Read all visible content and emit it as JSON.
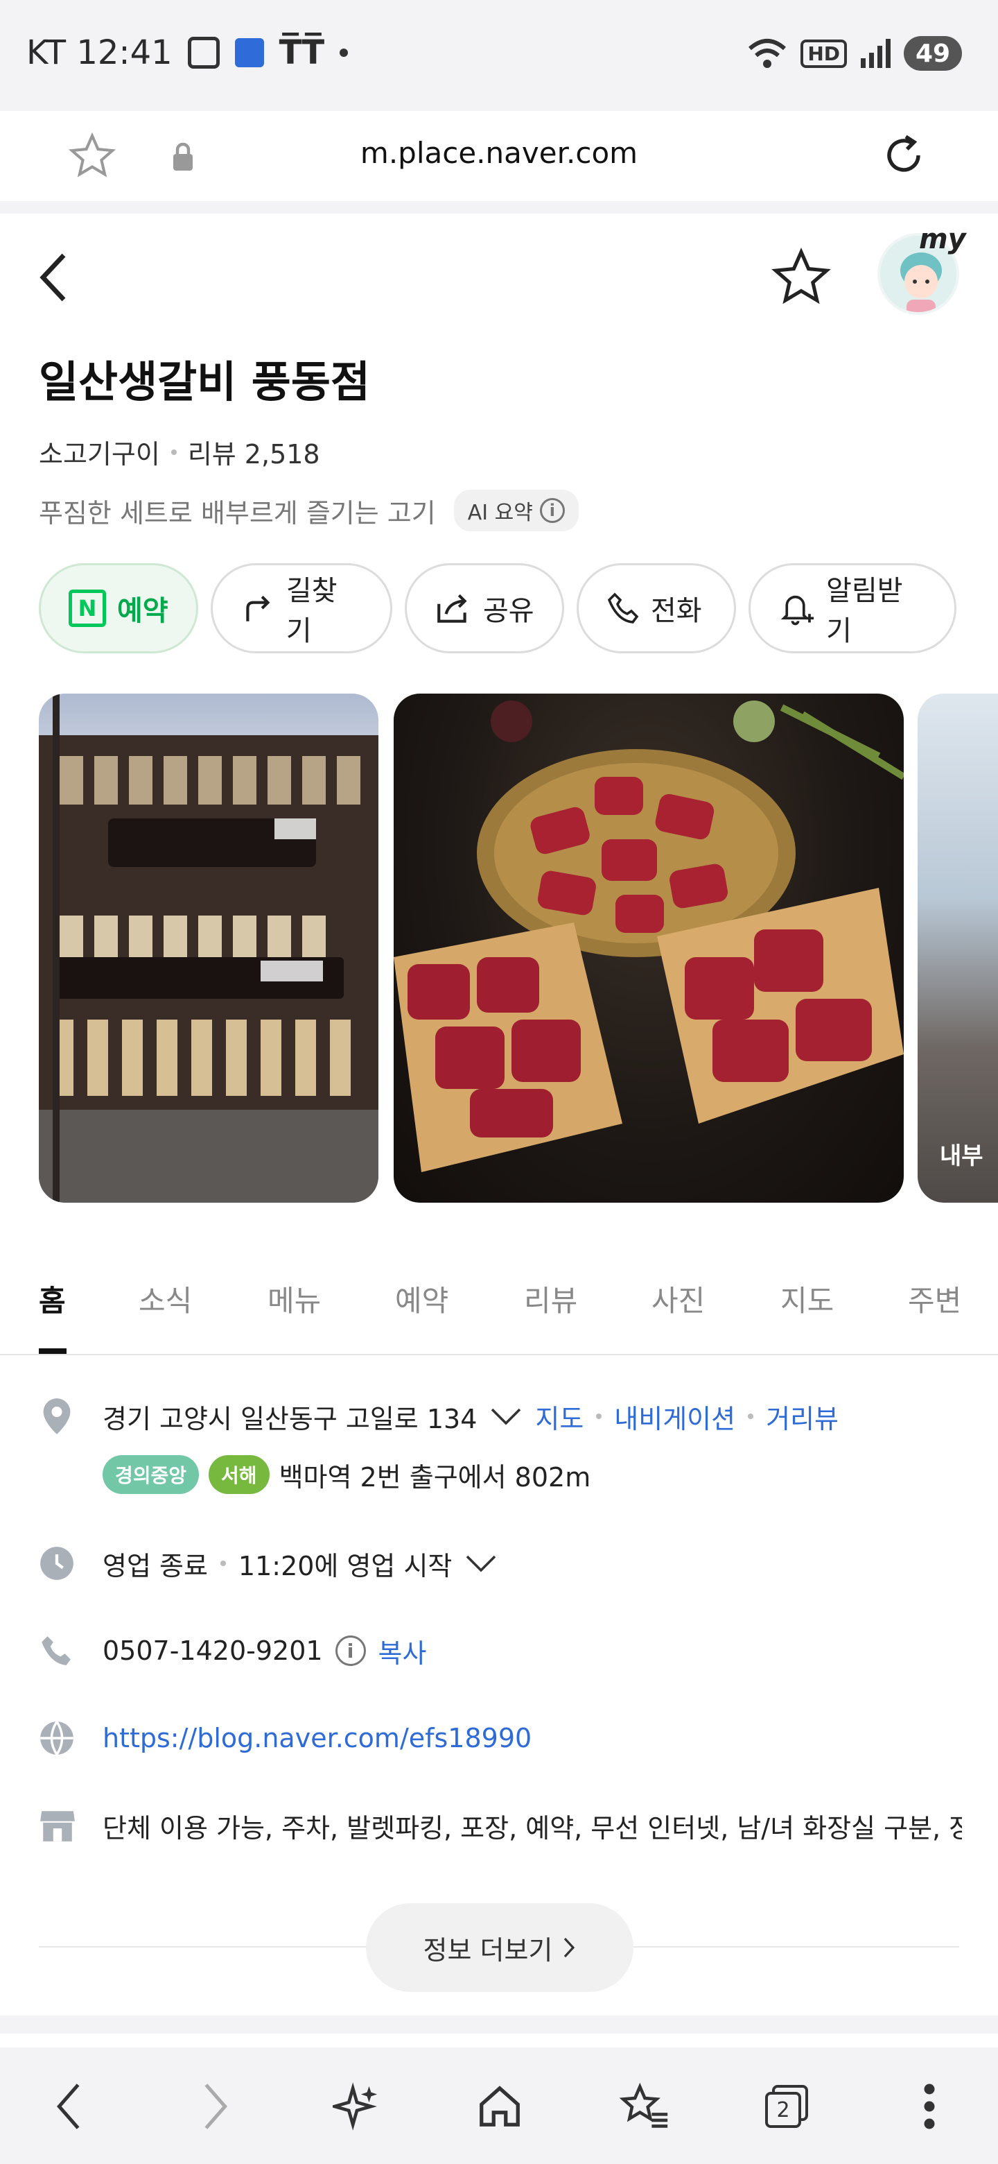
{
  "status_bar": {
    "carrier_time": "KT 12:41",
    "battery": "49",
    "signal_badge": "HD"
  },
  "browser": {
    "url": "m.place.naver.com"
  },
  "header": {
    "my_label": "my"
  },
  "place": {
    "name": "일산생갈비 풍동점",
    "category": "소고기구이",
    "review_count": "리뷰 2,518",
    "tagline": "푸짐한 세트로 배부르게 즐기는 고기",
    "ai_summary_label": "AI 요약"
  },
  "actions": [
    {
      "label": "예약"
    },
    {
      "label": "길찾기"
    },
    {
      "label": "공유"
    },
    {
      "label": "전화"
    },
    {
      "label": "알림받기"
    }
  ],
  "photos": {
    "third_label": "내부"
  },
  "tabs": [
    "홈",
    "소식",
    "메뉴",
    "예약",
    "리뷰",
    "사진",
    "지도",
    "주변"
  ],
  "info": {
    "address": "경기 고양시 일산동구 고일로 134",
    "address_links": [
      "지도",
      "내비게이션",
      "거리뷰"
    ],
    "subway_lines": [
      "경의중앙",
      "서해"
    ],
    "subway_text": "백마역 2번 출구에서 802m",
    "hours_status": "영업 종료",
    "hours_next": "11:20에 영업 시작",
    "phone": "0507-1420-9201",
    "copy_label": "복사",
    "website": "https://blog.naver.com/efs18990",
    "amenities": "단체 이용 가능, 주차, 발렛파킹, 포장, 예약, 무선 인터넷, 남/녀 화장실 구분, 장...",
    "more_label": "정보 더보기"
  },
  "bottom_nav": {
    "tab_count": "2"
  },
  "colors": {
    "naver_green": "#03c75a",
    "link_blue": "#2e6bd6"
  }
}
